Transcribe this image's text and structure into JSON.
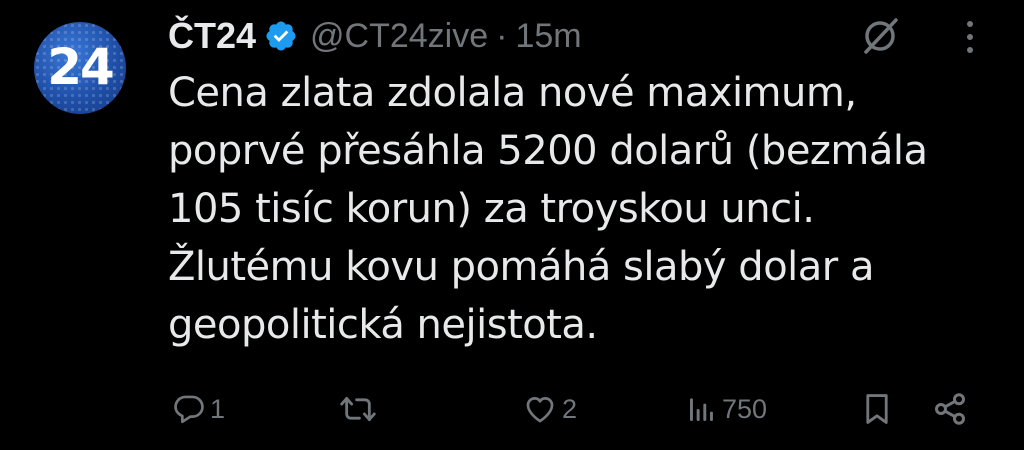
{
  "author": {
    "display_name": "ČT24",
    "handle": "@CT24zive",
    "separator": "·",
    "time": "15m",
    "avatar_text": "24",
    "verified_icon": "verified-badge-icon"
  },
  "tweet": {
    "text": "Cena zlata zdolala nové maximum,\npoprvé přesáhla 5200 dolarů (bezmála\n105 tisíc korun) za troyskou unci.\nŽlutému kovu pomáhá slabý dolar a\ngeopolitická nejistota."
  },
  "actions": {
    "reply_count": "1",
    "retweet_count": "",
    "like_count": "2",
    "views_count": "750"
  },
  "colors": {
    "background": "#000000",
    "text": "#e7e9ea",
    "muted": "#71767b",
    "verified": "#1d9bf0",
    "avatar": "#1f4fa8"
  },
  "icons": [
    "grok-icon",
    "more-icon",
    "reply-icon",
    "retweet-icon",
    "like-icon",
    "views-icon",
    "bookmark-icon",
    "share-icon"
  ]
}
